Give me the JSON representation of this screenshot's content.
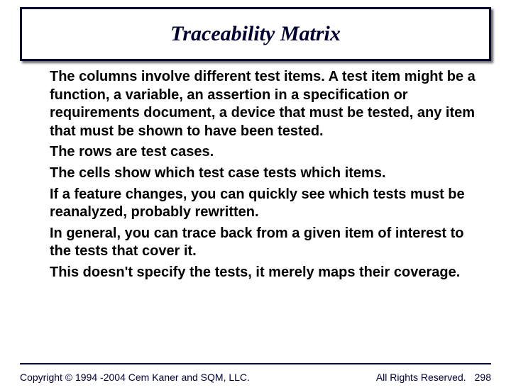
{
  "title": "Traceability Matrix",
  "paragraphs": [
    "The columns involve different test items. A test item might be a function, a variable, an assertion in a specification or requirements document, a device that must be tested, any item that must be shown to have been tested.",
    "The rows are test cases.",
    "The cells show which test case tests which items.",
    "If a feature changes, you can quickly see which tests must be reanalyzed, probably rewritten.",
    "In general, you can trace back from a given item of interest to the tests that cover it.",
    "This doesn't specify the tests, it merely maps their coverage."
  ],
  "footer": {
    "copyright": "Copyright © 1994 -2004 Cem Kaner and SQM, LLC.",
    "rights": "All Rights Reserved.",
    "page": "298"
  }
}
